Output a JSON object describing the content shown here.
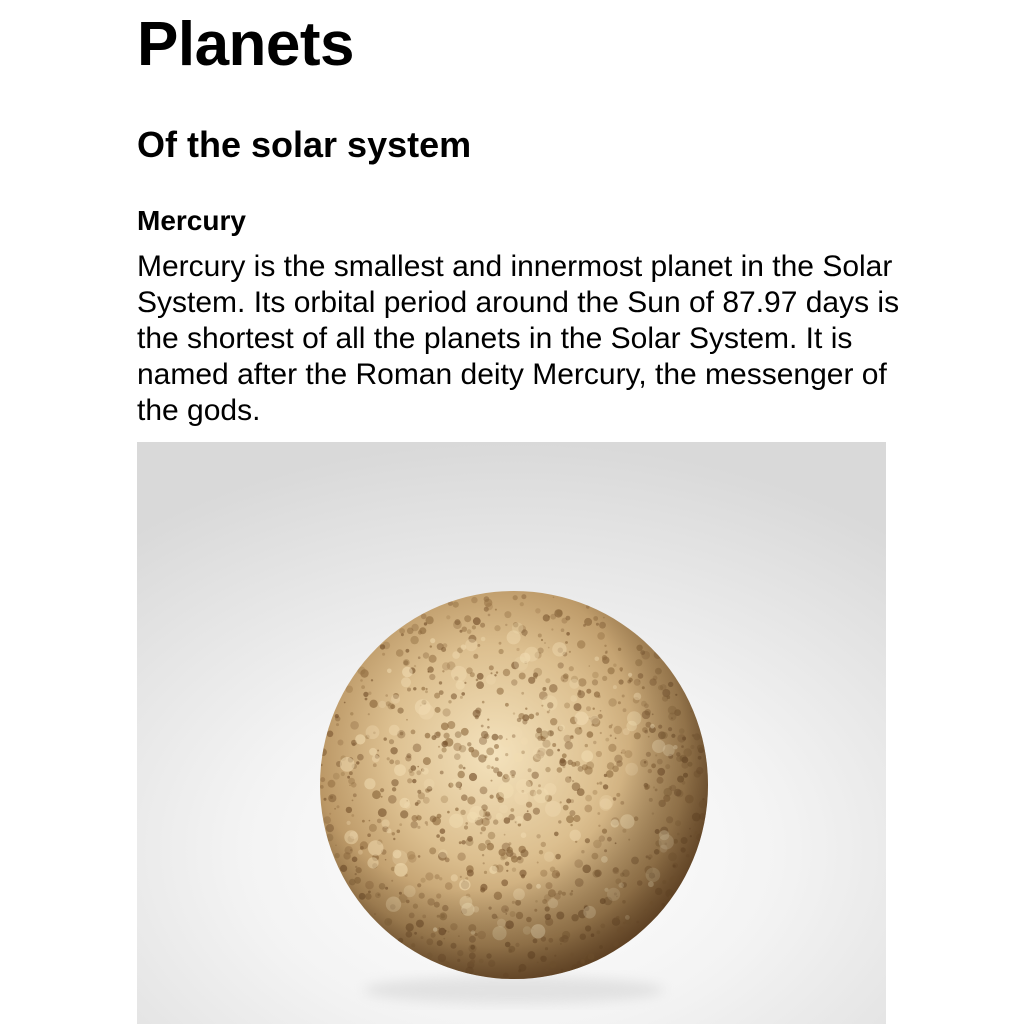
{
  "page": {
    "title": "Planets",
    "subtitle": "Of the solar system"
  },
  "planet": {
    "name": "Mercury",
    "description": "Mercury is the smallest and innermost planet in the Solar System. Its orbital period around the Sun of 87.97 days is the shortest of all the planets in the Solar System. It is named after the Roman deity Mercury, the messenger of the gods.",
    "image": {
      "subject": "mercury-planet",
      "colors": {
        "surface_light": "#f1dcb2",
        "surface_mid": "#c9a472",
        "surface_dark": "#7a5630",
        "crater": "#8e6a3e",
        "background_center": "#ffffff",
        "background_edge": "#d9d9d9"
      }
    }
  }
}
